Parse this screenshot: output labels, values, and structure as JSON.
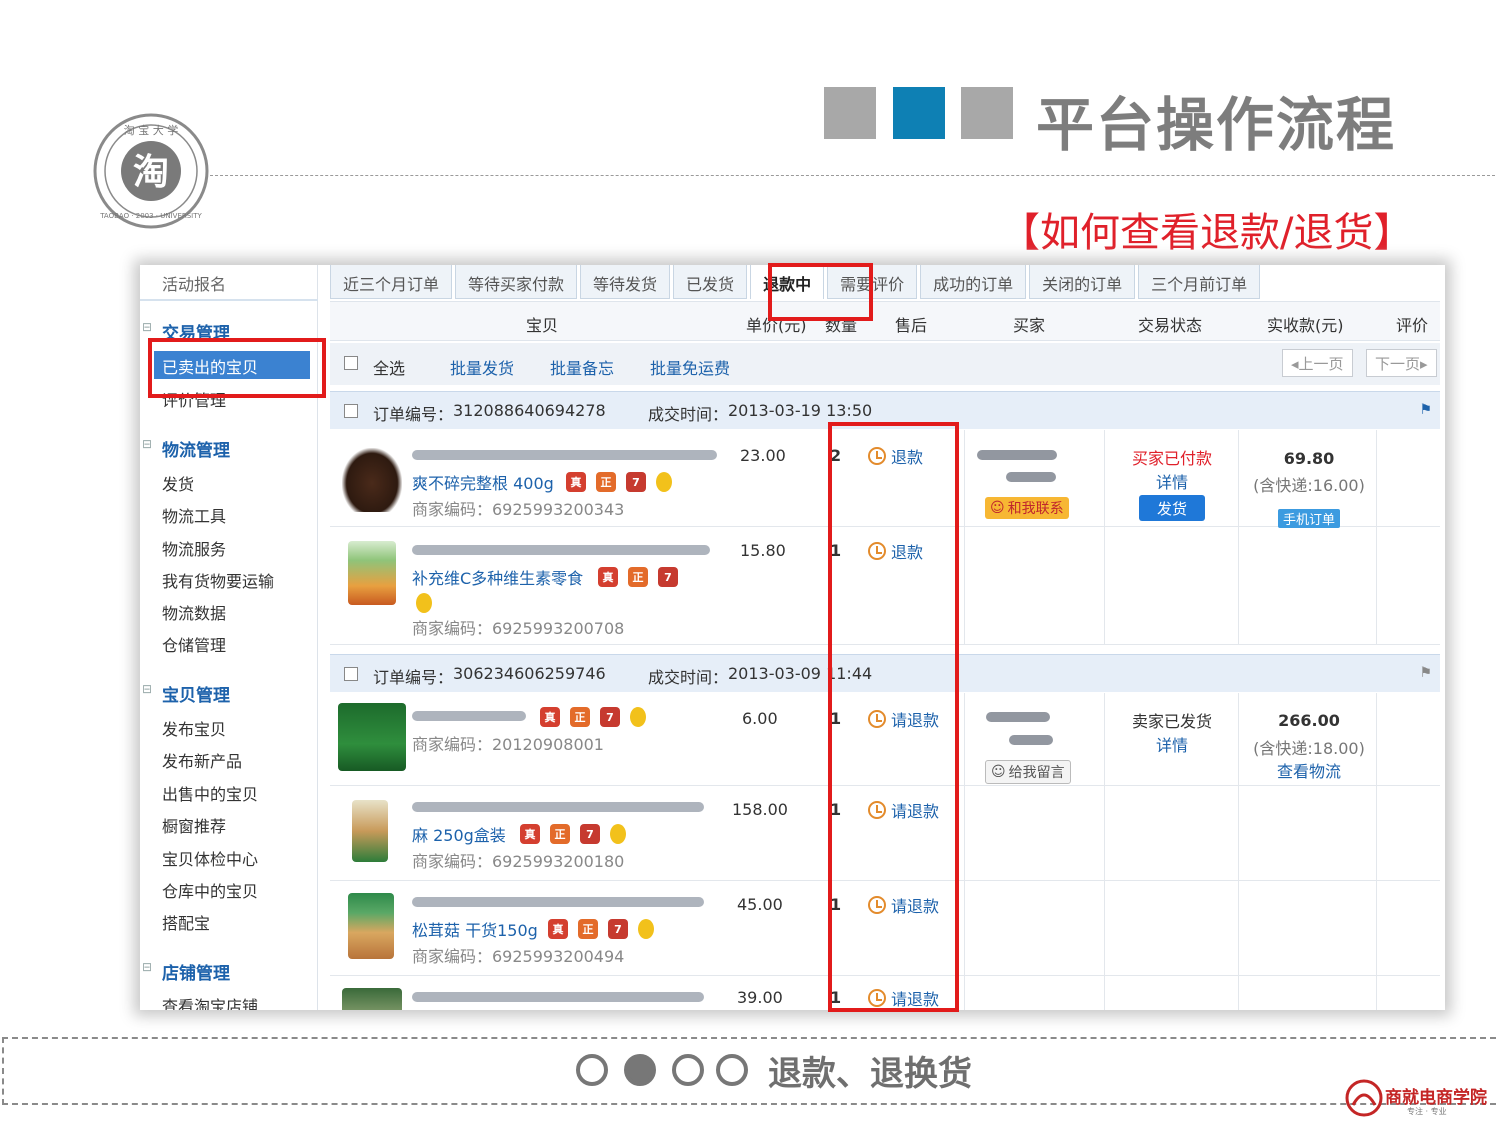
{
  "header": {
    "title": "平台操作流程",
    "subtitle": "【如何查看退款/退货】"
  },
  "seal": {
    "center_char": "淘",
    "arc_top": "淘宝大学",
    "arc_bottom": "TAOBAO · 2003 · UNIVERSITY"
  },
  "sidebar": {
    "top_item": "活动报名",
    "groups": [
      {
        "label": "交易管理",
        "items": [
          "已卖出的宝贝",
          "评价管理"
        ]
      },
      {
        "label": "物流管理",
        "items": [
          "发货",
          "物流工具",
          "物流服务",
          "我有货物要运输",
          "物流数据",
          "仓储管理"
        ]
      },
      {
        "label": "宝贝管理",
        "items": [
          "发布宝贝",
          "发布新产品",
          "出售中的宝贝",
          "橱窗推荐",
          "宝贝体检中心",
          "仓库中的宝贝",
          "搭配宝"
        ]
      },
      {
        "label": "店铺管理",
        "items": [
          "查看淘宝店铺"
        ]
      }
    ]
  },
  "tabs": [
    "近三个月订单",
    "等待买家付款",
    "等待发货",
    "已发货",
    "退款中",
    "需要评价",
    "成功的订单",
    "关闭的订单",
    "三个月前订单"
  ],
  "columns": {
    "item": "宝贝",
    "unit_price": "单价(元)",
    "quantity": "数量",
    "after_sale": "售后",
    "buyer": "买家",
    "status": "交易状态",
    "paid": "实收款(元)",
    "review": "评价"
  },
  "toolbar": {
    "select_all": "全选",
    "batch_ship": "批量发货",
    "batch_memo": "批量备忘",
    "batch_free_shipping": "批量免运费",
    "prev": "◂上一页",
    "next": "下一页▸"
  },
  "orders": [
    {
      "order_no_label": "订单编号：",
      "order_no": "312088640694278",
      "time_label": "成交时间：",
      "time": "2013-03-19 13:50",
      "status_line1": "买家已付款",
      "status_detail": "详情",
      "ship_button": "发货",
      "contact": "和我联系",
      "paid": "69.80",
      "shipping": "(含快递:16.00)",
      "mobile_order": "手机订单",
      "items": [
        {
          "title_visible": "爽不碎完整根 400g",
          "merchant": "商家编码：6925993200343",
          "price": "23.00",
          "qty": "2",
          "after_sale": "退款"
        },
        {
          "title_visible": "补充维C多种维生素零食",
          "merchant": "商家编码：6925993200708",
          "price": "15.80",
          "qty": "1",
          "after_sale": "退款"
        }
      ]
    },
    {
      "order_no_label": "订单编号：",
      "order_no": "306234606259746",
      "time_label": "成交时间：",
      "time": "2013-03-09 11:44",
      "status_line1": "卖家已发货",
      "status_detail": "详情",
      "contact": "给我留言",
      "paid": "266.00",
      "shipping": "(含快递:18.00)",
      "logistics": "查看物流",
      "items": [
        {
          "title_visible": "",
          "merchant": "商家编码：20120908001",
          "price": "6.00",
          "qty": "1",
          "after_sale": "请退款"
        },
        {
          "title_visible": "麻 250g盒装",
          "merchant": "商家编码：6925993200180",
          "price": "158.00",
          "qty": "1",
          "after_sale": "请退款"
        },
        {
          "title_visible": "松茸菇 干货150g",
          "merchant": "商家编码：6925993200494",
          "price": "45.00",
          "qty": "1",
          "after_sale": "请退款"
        },
        {
          "title_visible": "",
          "merchant": "",
          "price": "39.00",
          "qty": "1",
          "after_sale": "请退款"
        }
      ]
    }
  ],
  "badges": {
    "genuine": "真",
    "authentic": "正",
    "seven_day": "7"
  },
  "footer": {
    "text": "退款、退换货",
    "brand": "商就电商学院",
    "brand_sub": "专注 · 专业"
  },
  "colors": {
    "accent_blue": "#0e80b4",
    "highlight_red": "#e21b1b",
    "link_blue": "#1d62ab",
    "title_gray": "#7d7d7d"
  }
}
